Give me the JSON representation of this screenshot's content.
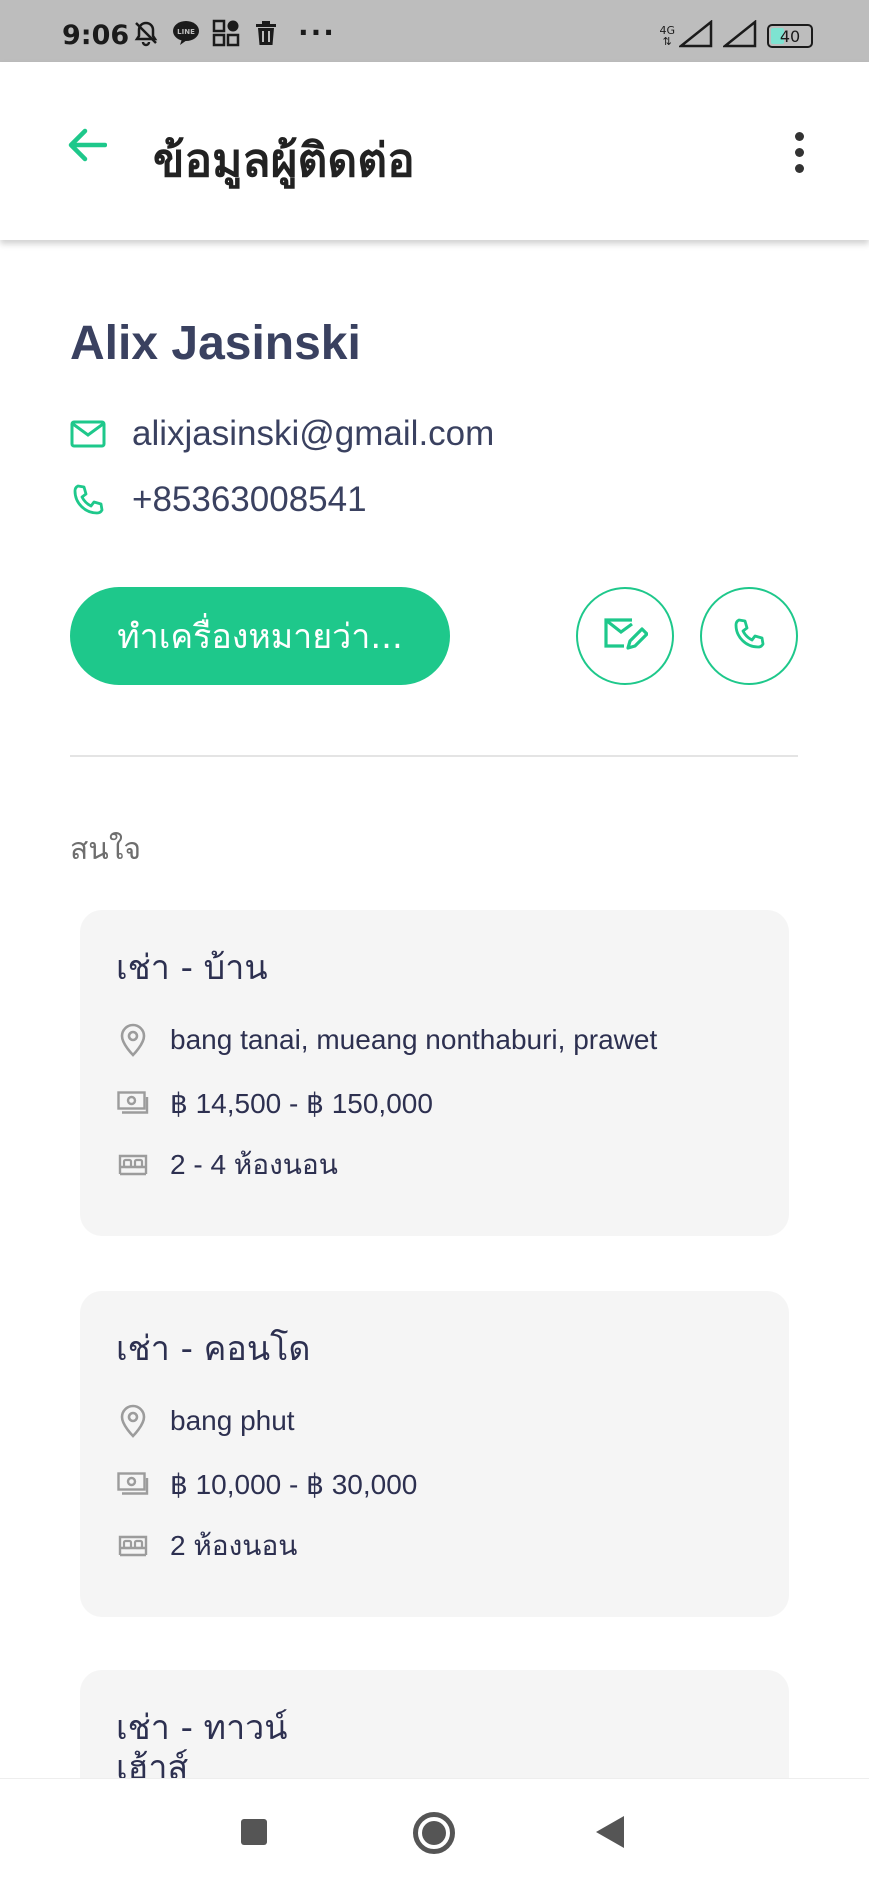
{
  "status_bar": {
    "time": "9:06",
    "network_label": "4G",
    "battery": "40",
    "battery_level_percent": 40,
    "more_label": "···",
    "icons": [
      "notifications-off-icon",
      "line-app-icon",
      "qr-grid-icon",
      "trash-icon",
      "signal-icon",
      "signal-icon",
      "battery-icon"
    ]
  },
  "app_bar": {
    "title": "ข้อมูลผู้ติดต่อ",
    "back_icon": "arrow-left-icon",
    "menu_icon": "more-vertical-icon"
  },
  "contact": {
    "name": "Alix Jasinski",
    "email": "alixjasinski@gmail.com",
    "phone": "+85363008541",
    "mark_button_label": "ทำเครื่องหมายว่า..."
  },
  "interests": {
    "label": "สนใจ",
    "items": [
      {
        "title": "เช่า - บ้าน",
        "location": "bang tanai, mueang nonthaburi, prawet",
        "price": "฿ 14,500 - ฿ 150,000",
        "bedrooms": "2 - 4 ห้องนอน"
      },
      {
        "title": "เช่า - คอนโด",
        "location": "bang phut",
        "price": "฿ 10,000 - ฿ 30,000",
        "bedrooms": "2 ห้องนอน"
      },
      {
        "title": "เช่า - ทาวน์เฮ้าส์"
      }
    ]
  },
  "colors": {
    "accent": "#1ec88b",
    "text_primary": "#3a4160",
    "card_bg": "#f5f5f5",
    "status_bar_bg": "#bdbdbd"
  }
}
